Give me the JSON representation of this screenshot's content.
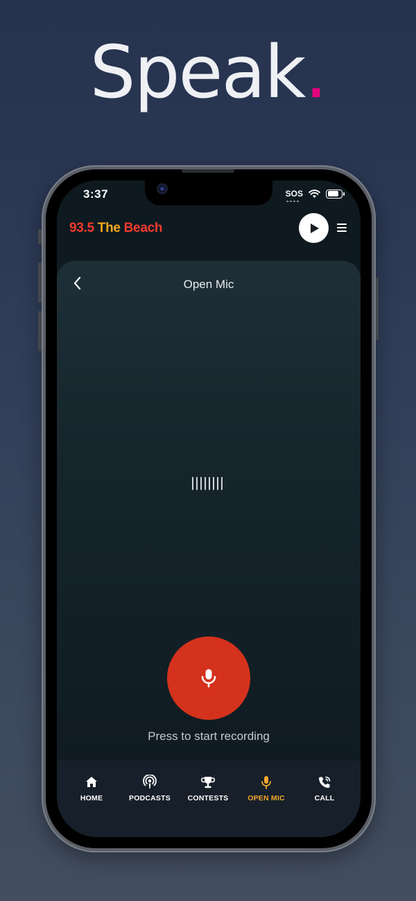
{
  "promo": {
    "headline": "Speak",
    "headline_dot": "."
  },
  "status_bar": {
    "time": "3:37",
    "sos": "SOS"
  },
  "header": {
    "brand_number": "93.5",
    "brand_the": "The",
    "brand_beach": "Beach",
    "play_icon": "play-icon",
    "menu_icon": "hamburger-menu-icon"
  },
  "panel": {
    "title": "Open Mic",
    "record_hint": "Press to start recording"
  },
  "tabbar": {
    "items": [
      {
        "label": "HOME",
        "icon": "home-icon",
        "active": false
      },
      {
        "label": "PODCASTS",
        "icon": "podcast-icon",
        "active": false
      },
      {
        "label": "CONTESTS",
        "icon": "trophy-icon",
        "active": false
      },
      {
        "label": "OPEN MIC",
        "icon": "microphone-icon",
        "active": true
      },
      {
        "label": "CALL",
        "icon": "phone-call-icon",
        "active": false
      }
    ]
  },
  "colors": {
    "accent_orange": "#f2a72a",
    "brand_red": "#ef3b2d",
    "record_red": "#d4321d",
    "headline_dot": "#e5007e"
  }
}
